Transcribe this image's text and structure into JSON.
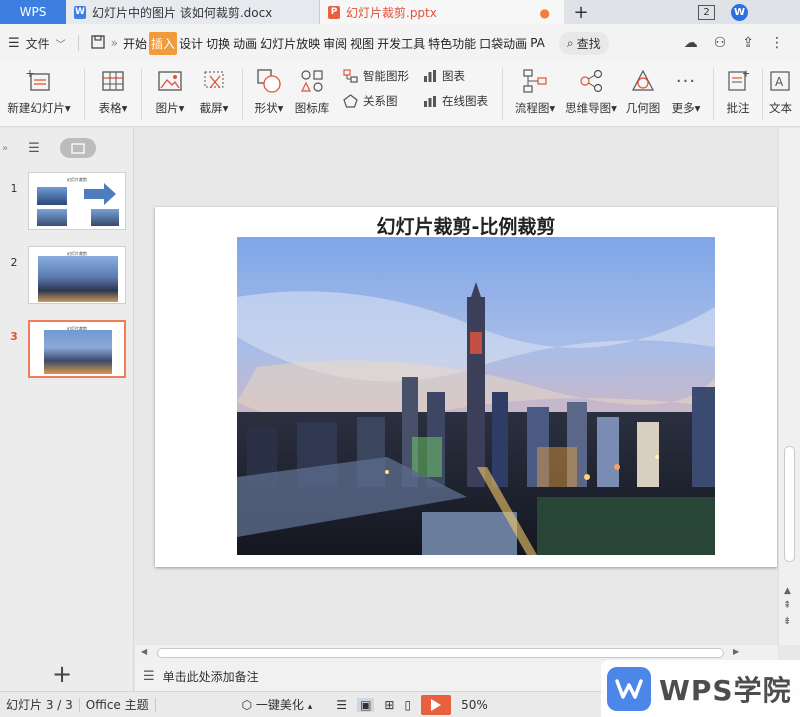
{
  "tabs": {
    "app": "WPS",
    "doc_title": "幻灯片中的图片 该如何裁剪.docx",
    "ppt_title": "幻灯片裁剪.pptx",
    "badge_num": "2"
  },
  "menu": {
    "file": "文件",
    "tabs": [
      "开始",
      "插入",
      "设计",
      "切换",
      "动画",
      "幻灯片放映",
      "审阅",
      "视图",
      "开发工具",
      "特色功能",
      "口袋动画",
      "PA"
    ],
    "active_tab": "插入",
    "search": "查找"
  },
  "ribbon": {
    "new_slide": "新建幻灯片",
    "table": "表格",
    "picture": "图片",
    "screenshot": "截屏",
    "shape": "形状",
    "icon_lib": "图标库",
    "smart_graphic": "智能图形",
    "relation": "关系图",
    "chart": "图表",
    "online_chart": "在线图表",
    "flowchart": "流程图",
    "mindmap": "思维导图",
    "geometry": "几何图",
    "more": "更多",
    "comment": "批注",
    "text": "文本"
  },
  "slides": {
    "nums": [
      "1",
      "2",
      "3"
    ],
    "thumb_title": "幻灯片裁剪"
  },
  "slide": {
    "title": "幻灯片裁剪-比例裁剪"
  },
  "notes": {
    "placeholder": "单击此处添加备注"
  },
  "status": {
    "slide_count": "幻灯片 3 / 3",
    "theme": "Office 主题",
    "beautify": "一键美化",
    "zoom": "50%"
  },
  "watermark": {
    "text": "WPS学院"
  },
  "colors": {
    "accent_orange": "#f29b3a",
    "ppt_red": "#e8613f",
    "wps_blue": "#3c7fe0"
  }
}
